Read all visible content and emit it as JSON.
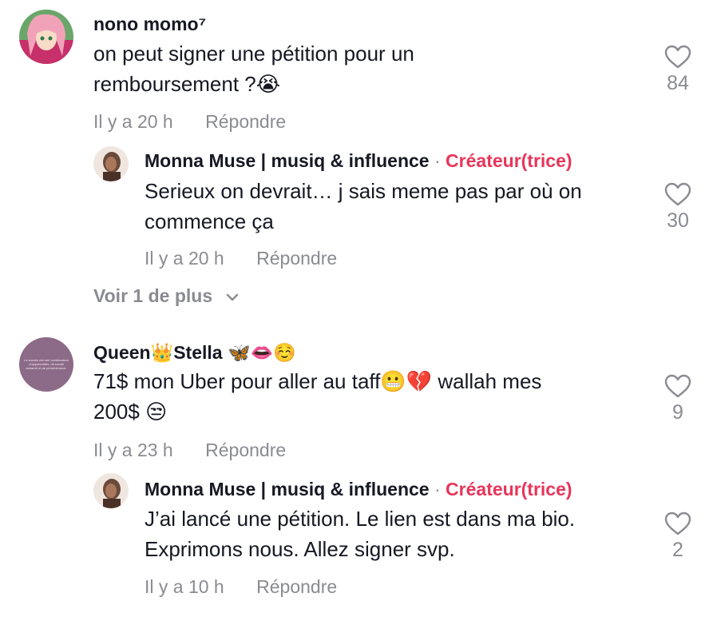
{
  "comments": [
    {
      "username": "nono momo⁷",
      "text_line1": "on peut signer une pétition pour un",
      "text_line2": "remboursement ?😭",
      "time": "Il y a 20 h",
      "reply": "Répondre",
      "likes": "84",
      "replies": [
        {
          "username": "Monna Muse | musiq & influence",
          "separator": "·",
          "badge": "Créateur(trice)",
          "text_line1": "Serieux on devrait… j sais meme pas par où on",
          "text_line2": "commence ça",
          "time": "Il y a 20 h",
          "reply": "Répondre",
          "likes": "30"
        }
      ],
      "more_label": "Voir 1 de plus"
    },
    {
      "username": "Queen👑Stella 🦋👄☺️",
      "text_line1": "71$ mon Uber pour aller au taff😬💔 wallah mes",
      "text_line2": "200$ 😒",
      "time": "Il y a 23 h",
      "reply": "Répondre",
      "likes": "9",
      "avatar_text": "Le succès est une combinaison d'opportunités, de travail acharné et de persévérance.",
      "replies": [
        {
          "username": "Monna Muse | musiq & influence",
          "separator": "·",
          "badge": "Créateur(trice)",
          "text_line1": "J’ai lancé une pétition. Le lien est dans ma bio.",
          "text_line2": "Exprimons nous. Allez signer svp.",
          "time": "Il y a 10 h",
          "reply": "Répondre",
          "likes": "2"
        }
      ]
    }
  ],
  "colors": {
    "text": "#161823",
    "muted": "#8a8b91",
    "creator": "#e8355a"
  }
}
